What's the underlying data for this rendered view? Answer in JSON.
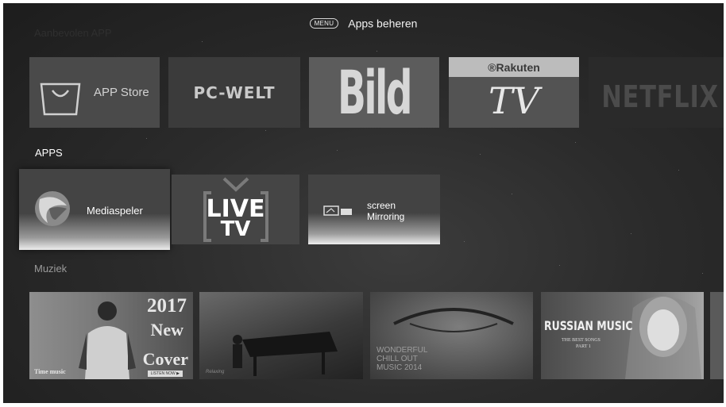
{
  "header": {
    "menu_key": "MENU",
    "title": "Apps beheren"
  },
  "sections": {
    "recommended": "Aanbevolen APP",
    "apps": "APPS",
    "music": "Muziek"
  },
  "recommended_tiles": {
    "app_store": "APP Store",
    "pcwelt": "PC-WELT",
    "bild": "Bild",
    "rakuten": "Rakuten",
    "rakuten_tv": "TV",
    "netflix": "NETFLIX"
  },
  "apps": {
    "mediaspeler": "Mediaspeler",
    "live": "LIVE",
    "tv": "TV",
    "mirroring": "screen\nMirroring"
  },
  "music": {
    "cover_year": "2017",
    "cover_new": "New",
    "cover_cover": "Cover",
    "cover_timemusic": "Time music",
    "cover_button": "LISTEN NOW ▶",
    "piano_caption": "Relaxing",
    "chill_text": "WONDERFUL\nCHILL OUT\nMUSIC 2014",
    "russian_title": "RUSSIAN MUSIC",
    "russian_sub1": "THE BEST SONGS",
    "russian_sub2": "PART 1"
  },
  "colors": {
    "background": "#2b2b2b",
    "rakuten_bar": "#bcbcbc",
    "focus_highlight": "#ececec"
  },
  "icons": {
    "app_store": "shopping-bag-icon",
    "mediaspeler": "play-icon",
    "live_tv": "tv-antenna-icon",
    "mirroring": "screen-mirroring-icon"
  }
}
